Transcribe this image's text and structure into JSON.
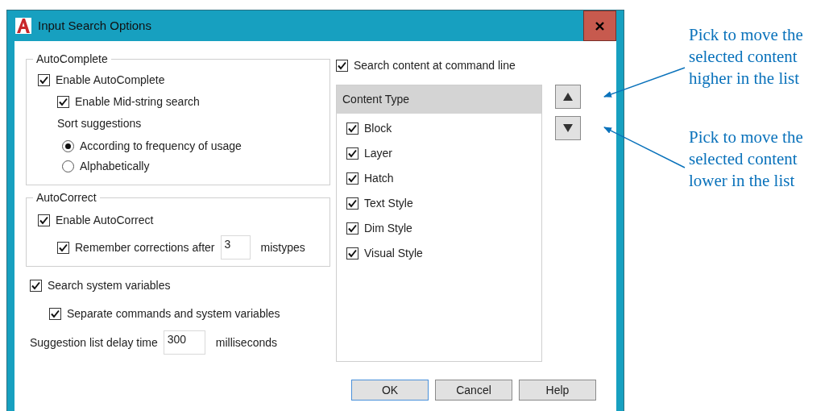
{
  "window": {
    "title": "Input Search Options"
  },
  "autocomplete": {
    "legend": "AutoComplete",
    "options": [
      {
        "label": "Enable AutoComplete",
        "checked": true,
        "indent": false
      },
      {
        "label": "Enable Mid-string search",
        "checked": true,
        "indent": true
      }
    ],
    "sort_label": "Sort suggestions",
    "sort_options": [
      {
        "label": "According to frequency of usage",
        "selected": true
      },
      {
        "label": "Alphabetically",
        "selected": false
      }
    ]
  },
  "autocorrect": {
    "legend": "AutoCorrect",
    "enable": {
      "label": "Enable AutoCorrect",
      "checked": true
    },
    "remember": {
      "label": "Remember corrections after",
      "checked": true,
      "value": "3",
      "suffix": "mistypes"
    }
  },
  "search_system_variables": {
    "label": "Search system variables",
    "checked": true
  },
  "separate_commands": {
    "label": "Separate commands and system variables",
    "checked": true
  },
  "delay": {
    "label": "Suggestion list delay time",
    "value": "300",
    "suffix": "milliseconds"
  },
  "search_content": {
    "label": "Search content at command line",
    "checked": true
  },
  "content_list": {
    "header": "Content Type",
    "items": [
      {
        "label": "Block",
        "checked": true
      },
      {
        "label": "Layer",
        "checked": true
      },
      {
        "label": "Hatch",
        "checked": true
      },
      {
        "label": "Text Style",
        "checked": true
      },
      {
        "label": "Dim Style",
        "checked": true
      },
      {
        "label": "Visual Style",
        "checked": true
      }
    ]
  },
  "buttons": [
    {
      "label": "OK",
      "default": true
    },
    {
      "label": "Cancel",
      "default": false
    },
    {
      "label": "Help",
      "default": false
    }
  ],
  "callouts": [
    {
      "lines": [
        "Pick to move the",
        "selected content",
        "higher in the list"
      ]
    },
    {
      "lines": [
        "Pick to move the",
        "selected content",
        "lower in the list"
      ]
    }
  ]
}
